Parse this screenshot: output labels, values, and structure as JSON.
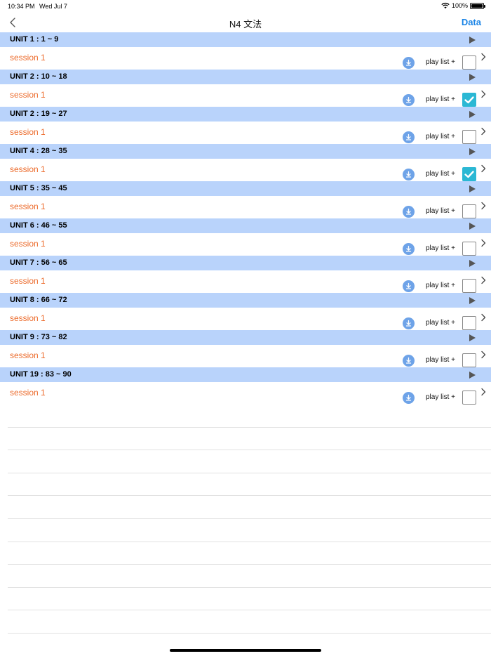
{
  "status_bar": {
    "time": "10:34 PM",
    "date": "Wed Jul 7",
    "battery": "100%"
  },
  "nav": {
    "title": "N4 文法",
    "data_label": "Data"
  },
  "row_labels": {
    "session": "session 1",
    "playlist": "play list +"
  },
  "units": [
    {
      "title": "UNIT 1 : 1 ~ 9",
      "session": "session 1",
      "playlist": "play list +",
      "checked": false
    },
    {
      "title": "UNIT 2 : 10 ~ 18",
      "session": "session 1",
      "playlist": "play list +",
      "checked": true
    },
    {
      "title": "UNIT 2 : 19 ~ 27",
      "session": "session 1",
      "playlist": "play list +",
      "checked": false
    },
    {
      "title": "UNIT 4 : 28 ~ 35",
      "session": "session 1",
      "playlist": "play list +",
      "checked": true
    },
    {
      "title": "UNIT 5 : 35 ~ 45",
      "session": "session 1",
      "playlist": "play list +",
      "checked": false
    },
    {
      "title": "UNIT 6 : 46 ~ 55",
      "session": "session 1",
      "playlist": "play list +",
      "checked": false
    },
    {
      "title": "UNIT 7 : 56 ~ 65",
      "session": "session 1",
      "playlist": "play list +",
      "checked": false
    },
    {
      "title": "UNIT 8 : 66 ~ 72",
      "session": "session 1",
      "playlist": "play list +",
      "checked": false
    },
    {
      "title": "UNIT 9 : 73 ~ 82",
      "session": "session 1",
      "playlist": "play list +",
      "checked": false
    },
    {
      "title": "UNIT 19 : 83 ~ 90",
      "session": "session 1",
      "playlist": "play list +",
      "checked": false
    }
  ],
  "colors": {
    "header_bg": "#b9d3fb",
    "session_text": "#ec6a2a",
    "accent": "#1a84e6",
    "checkbox_checked": "#2bb8d4",
    "download_icon": "#6ea3e8"
  },
  "icons": {
    "back": "chevron-left-icon",
    "play": "play-triangle-icon",
    "download": "download-icon",
    "checkbox": "checkbox-icon",
    "disclosure": "chevron-right-icon",
    "wifi": "wifi-icon",
    "battery": "battery-icon"
  }
}
